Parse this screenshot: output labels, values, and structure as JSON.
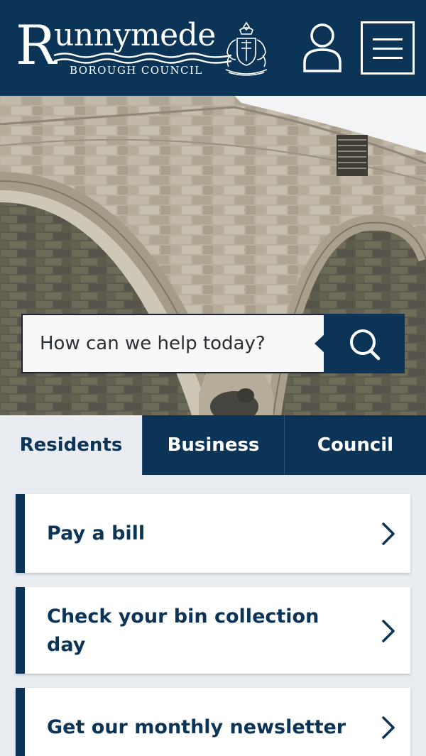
{
  "header": {
    "logo": {
      "initial": "R",
      "word": "unnymede",
      "subtitle": "BOROUGH COUNCIL"
    },
    "icons": {
      "user": "user-icon",
      "menu": "hamburger-menu-icon",
      "crest": "coat-of-arms-icon"
    },
    "colors": {
      "brand": "#0b3457",
      "text_on_brand": "#ffffff"
    }
  },
  "hero": {
    "image": "stone-bridge-arches-photo",
    "search": {
      "placeholder": "How can we help today?",
      "button_icon": "search-icon"
    }
  },
  "tabs": [
    {
      "label": "Residents",
      "active": true
    },
    {
      "label": "Business",
      "active": false
    },
    {
      "label": "Council",
      "active": false
    }
  ],
  "cards": [
    {
      "label": "Pay a bill",
      "icon": "chevron-right-icon"
    },
    {
      "label": "Check your bin collection day",
      "icon": "chevron-right-icon"
    },
    {
      "label": "Get our monthly newsletter",
      "icon": "chevron-right-icon"
    }
  ]
}
